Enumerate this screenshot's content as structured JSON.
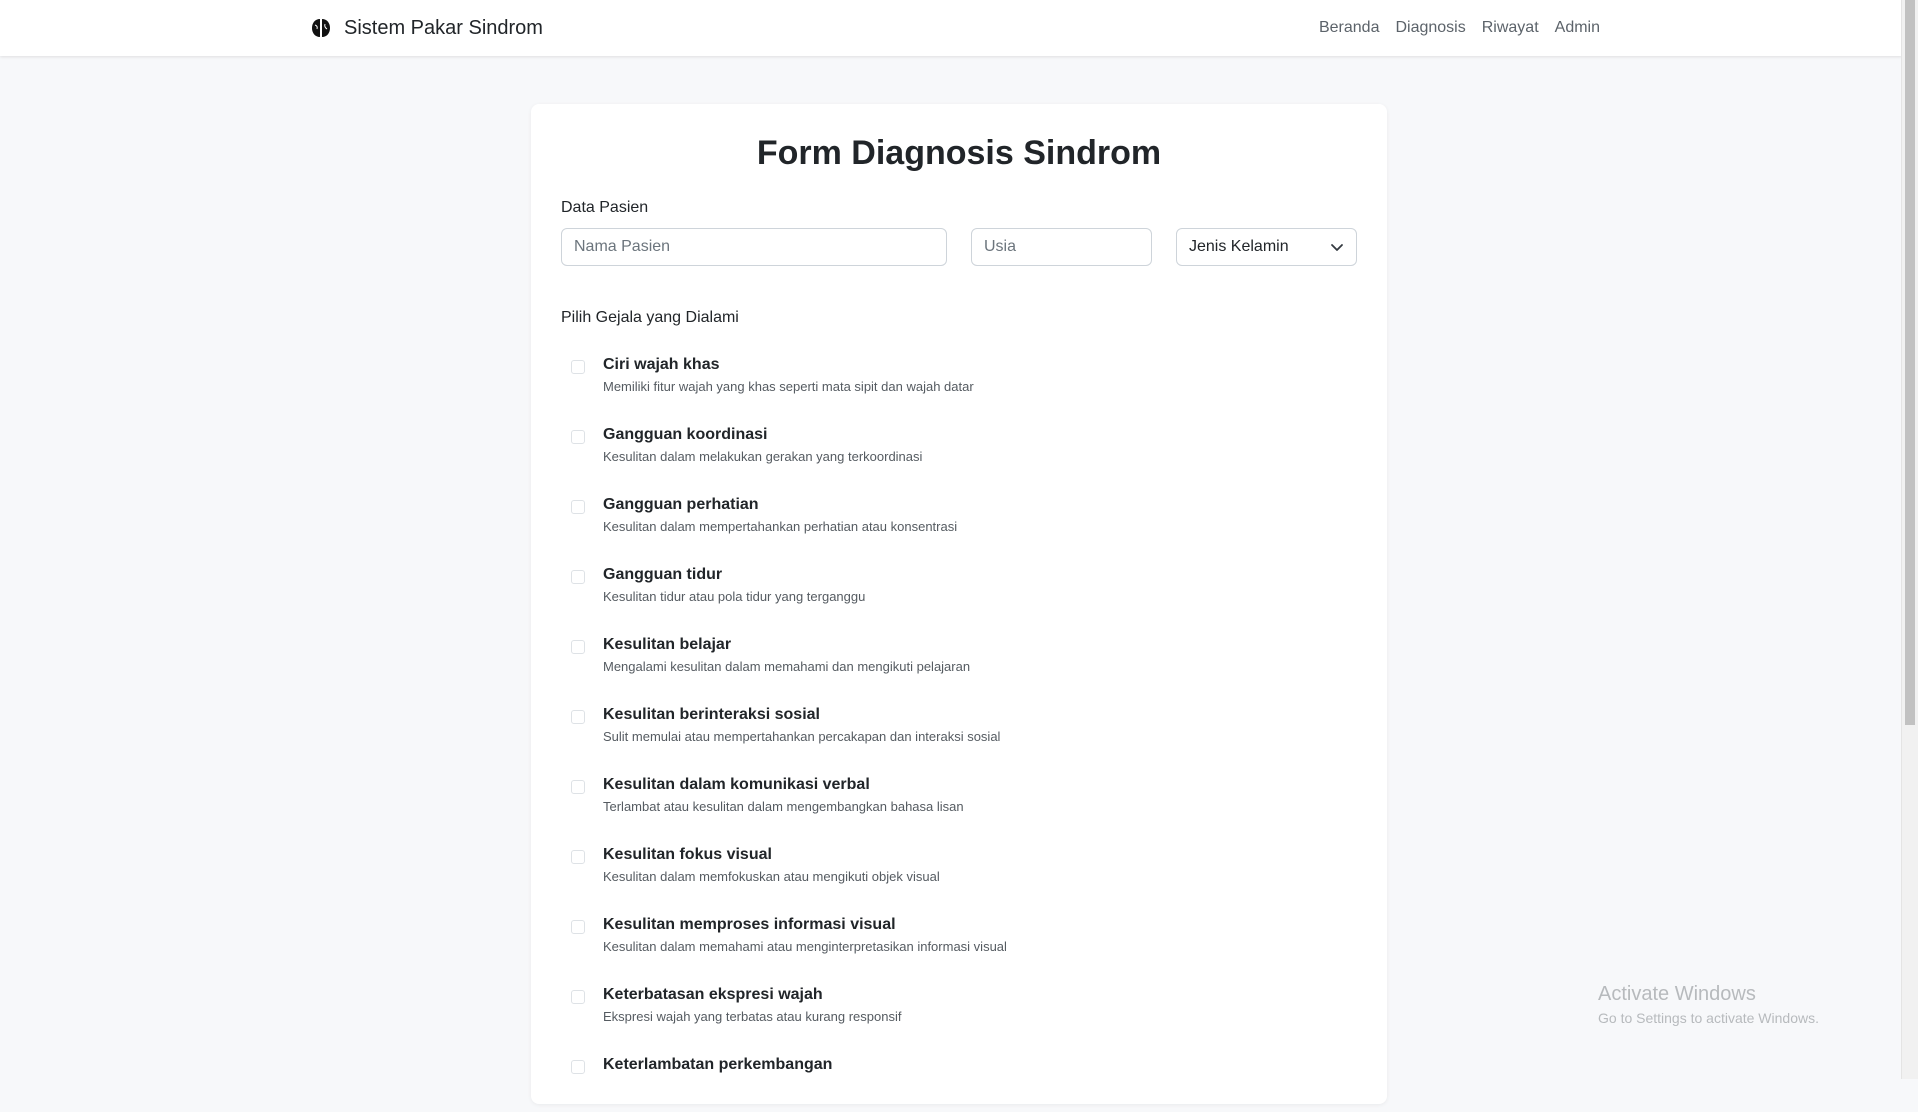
{
  "navbar": {
    "brand": "Sistem Pakar Sindrom",
    "links": [
      "Beranda",
      "Diagnosis",
      "Riwayat",
      "Admin"
    ]
  },
  "form": {
    "title": "Form Diagnosis Sindrom",
    "patient_section_label": "Data Pasien",
    "name_placeholder": "Nama Pasien",
    "age_placeholder": "Usia",
    "gender_select": "Jenis Kelamin",
    "symptoms_label": "Pilih Gejala yang Dialami",
    "symptoms": [
      {
        "title": "Ciri wajah khas",
        "desc": "Memiliki fitur wajah yang khas seperti mata sipit dan wajah datar"
      },
      {
        "title": "Gangguan koordinasi",
        "desc": "Kesulitan dalam melakukan gerakan yang terkoordinasi"
      },
      {
        "title": "Gangguan perhatian",
        "desc": "Kesulitan dalam mempertahankan perhatian atau konsentrasi"
      },
      {
        "title": "Gangguan tidur",
        "desc": "Kesulitan tidur atau pola tidur yang terganggu"
      },
      {
        "title": "Kesulitan belajar",
        "desc": "Mengalami kesulitan dalam memahami dan mengikuti pelajaran"
      },
      {
        "title": "Kesulitan berinteraksi sosial",
        "desc": "Sulit memulai atau mempertahankan percakapan dan interaksi sosial"
      },
      {
        "title": "Kesulitan dalam komunikasi verbal",
        "desc": "Terlambat atau kesulitan dalam mengembangkan bahasa lisan"
      },
      {
        "title": "Kesulitan fokus visual",
        "desc": "Kesulitan dalam memfokuskan atau mengikuti objek visual"
      },
      {
        "title": "Kesulitan memproses informasi visual",
        "desc": "Kesulitan dalam memahami atau menginterpretasikan informasi visual"
      },
      {
        "title": "Keterbatasan ekspresi wajah",
        "desc": "Ekspresi wajah yang terbatas atau kurang responsif"
      },
      {
        "title": "Keterlambatan perkembangan",
        "desc": ""
      }
    ]
  },
  "watermark": {
    "title": "Activate Windows",
    "subtitle": "Go to Settings to activate Windows."
  }
}
